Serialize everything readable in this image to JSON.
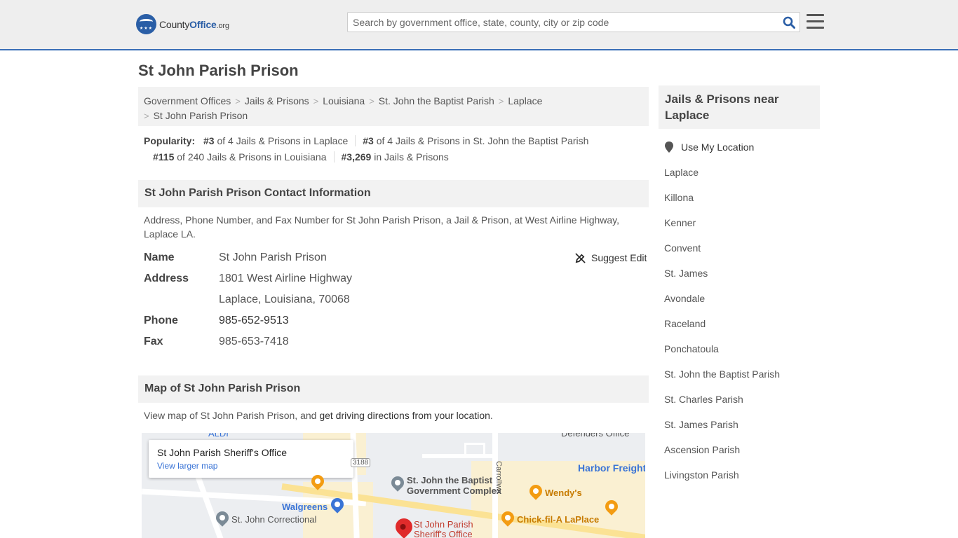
{
  "header": {
    "logo_text_prefix": "County",
    "logo_text_bold": "Office",
    "logo_text_suffix": ".org",
    "search_placeholder": "Search by government office, state, county, city or zip code",
    "accent_color": "#2a5ea6",
    "icons": [
      "search-icon",
      "hamburger-menu-icon"
    ]
  },
  "page": {
    "title": "St John Parish Prison"
  },
  "breadcrumb": [
    "Government Offices",
    "Jails & Prisons",
    "Louisiana",
    "St. John the Baptist Parish",
    "Laplace",
    "St John Parish Prison"
  ],
  "popularity": {
    "label": "Popularity:",
    "items": [
      {
        "rank": "#3",
        "text": " of 4 Jails & Prisons in Laplace"
      },
      {
        "rank": "#3",
        "text": " of 4 Jails & Prisons in St. John the Baptist Parish"
      },
      {
        "rank": "#115",
        "text": " of 240 Jails & Prisons in Louisiana"
      },
      {
        "rank": "#3,269",
        "text": " in Jails & Prisons"
      }
    ]
  },
  "contact": {
    "heading": "St John Parish Prison Contact Information",
    "description": "Address, Phone Number, and Fax Number for St John Parish Prison, a Jail & Prison, at West Airline Highway, Laplace LA.",
    "suggest_edit": "Suggest Edit",
    "name_label": "Name",
    "name": "St John Parish Prison",
    "address_label": "Address",
    "address_line1": "1801 West Airline Highway",
    "address_line2": "Laplace, Louisiana, 70068",
    "phone_label": "Phone",
    "phone": "985-652-9513",
    "fax_label": "Fax",
    "fax": "985-653-7418"
  },
  "map": {
    "heading": "Map of St John Parish Prison",
    "desc_prefix": "View map of St John Parish Prison, and ",
    "desc_link": "get driving directions from your location",
    "desc_suffix": ".",
    "card_title": "St John Parish Sheriff's Office",
    "card_link": "View larger map",
    "labels": {
      "aldi": "ALDI",
      "defenders": "Defenders Office",
      "carrollwood": "Carrollwo",
      "road_3188": "3188",
      "harbor": "Harbor Freight",
      "govt_complex_1": "St. John the Baptist",
      "govt_complex_2": "Government Complex",
      "wendys": "Wendy's",
      "walgreens": "Walgreens",
      "correctional": "St. John Correctional",
      "chick": "Chick-fil-A LaPlace",
      "sheriff_1": "St John Parish",
      "sheriff_2": "Sheriff's Office"
    }
  },
  "sidebar": {
    "heading": "Jails & Prisons near Laplace",
    "use_location": "Use My Location",
    "links": [
      "Laplace",
      "Killona",
      "Kenner",
      "Convent",
      "St. James",
      "Avondale",
      "Raceland",
      "Ponchatoula",
      "St. John the Baptist Parish",
      "St. Charles Parish",
      "St. James Parish",
      "Ascension Parish",
      "Livingston Parish"
    ]
  }
}
